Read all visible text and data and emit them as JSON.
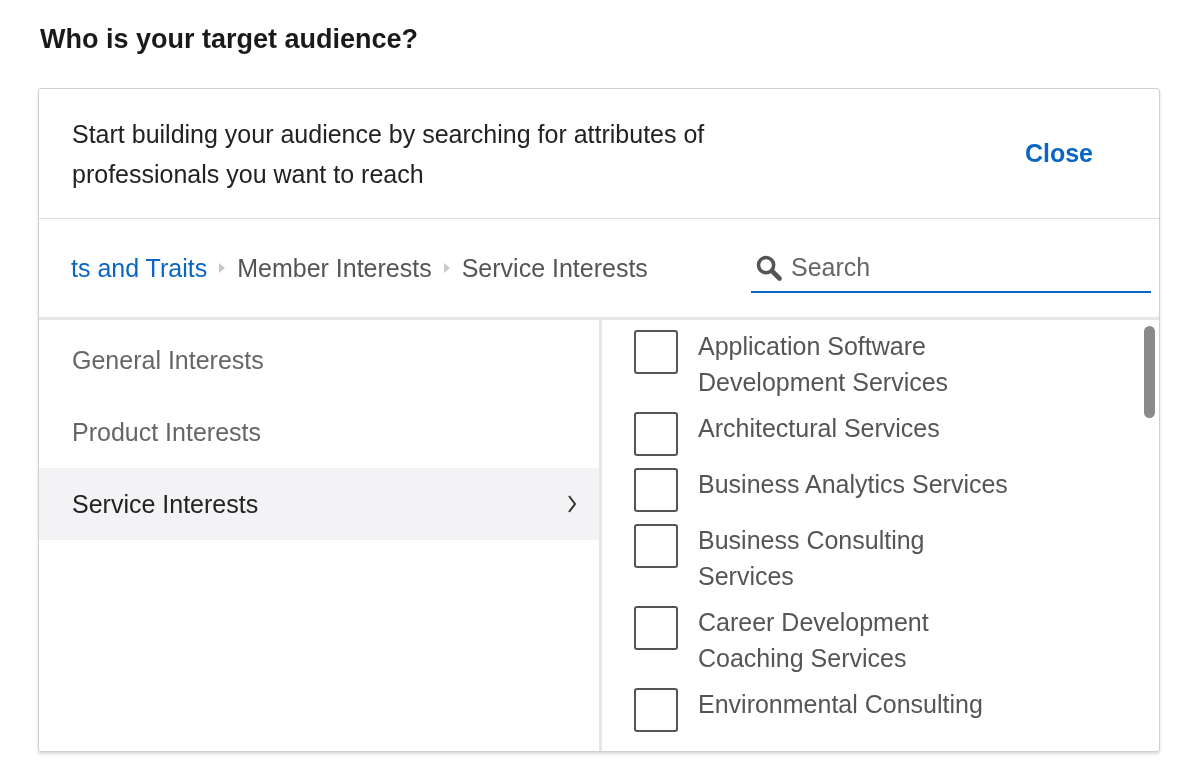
{
  "heading": "Who is your target audience?",
  "panel": {
    "intro": "Start building your audience by searching for attributes of professionals you want to reach",
    "close": "Close"
  },
  "breadcrumbs": [
    {
      "label": "ts and Traits",
      "link": true
    },
    {
      "label": "Member Interests",
      "link": false
    },
    {
      "label": "Service Interests",
      "link": false
    }
  ],
  "search": {
    "placeholder": "Search"
  },
  "categories": [
    {
      "label": "General Interests",
      "selected": false
    },
    {
      "label": "Product Interests",
      "selected": false
    },
    {
      "label": "Service Interests",
      "selected": true
    }
  ],
  "options": [
    {
      "label": "Application Software Development Services",
      "checked": false
    },
    {
      "label": "Architectural Services",
      "checked": false
    },
    {
      "label": "Business Analytics Services",
      "checked": false
    },
    {
      "label": "Business Consulting Services",
      "checked": false
    },
    {
      "label": "Career Development Coaching Services",
      "checked": false
    },
    {
      "label": "Environmental Consulting",
      "checked": false
    }
  ]
}
